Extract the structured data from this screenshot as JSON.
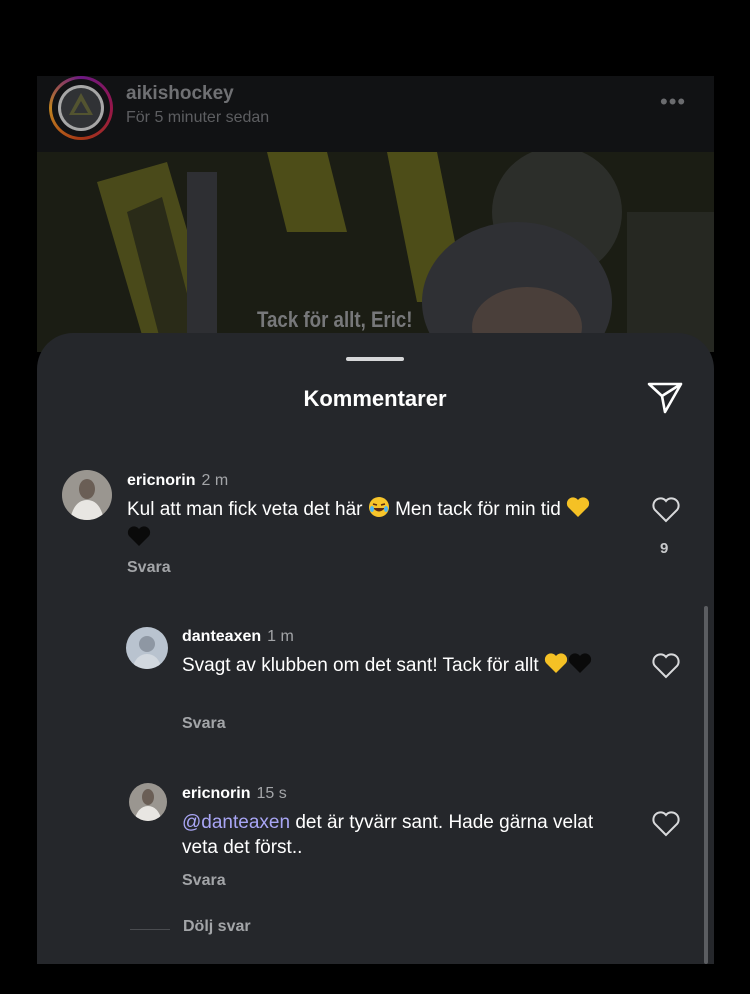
{
  "story": {
    "username": "aikishockey",
    "time_ago": "För 5 minuter sedan",
    "more_icon": "more-horizontal-icon",
    "caption": "Tack för allt, Eric!"
  },
  "sheet": {
    "title": "Kommentarer",
    "share_icon": "send-icon"
  },
  "comments": [
    {
      "user": "ericnorin",
      "time": "2 m",
      "text_before": "Kul att man fick veta det här ",
      "text_after": " Men tack för min tid ",
      "reply_label": "Svara",
      "likes": "9"
    }
  ],
  "replies": [
    {
      "user": "danteaxen",
      "time": "1 m",
      "text": "Svagt av klubben om det sant! Tack för allt",
      "reply_label": "Svara"
    },
    {
      "user": "ericnorin",
      "time": "15 s",
      "mention": "@danteaxen",
      "text": " det är tyvärr sant. Hade gärna velat veta det först..",
      "reply_label": "Svara"
    }
  ],
  "hide_replies_label": "Dölj svar",
  "colors": {
    "sheet_bg": "#25272b",
    "mention": "#a9a6f5",
    "muted_text": "#a3a5a8"
  }
}
